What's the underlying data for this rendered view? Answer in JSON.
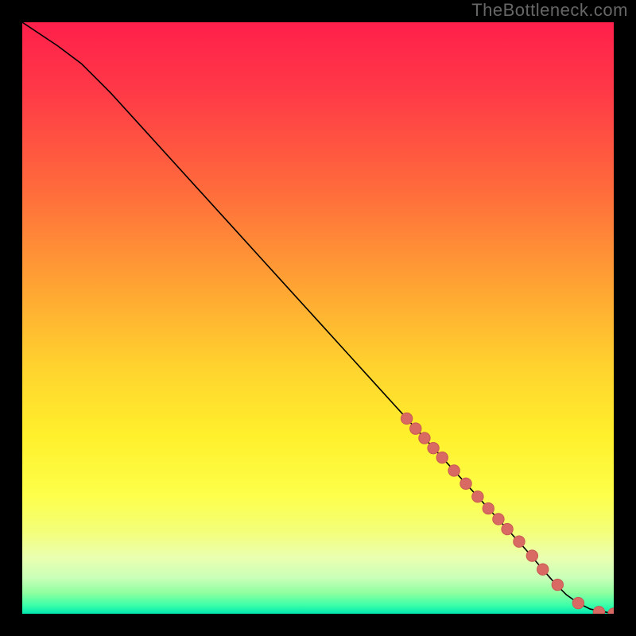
{
  "watermark": "TheBottleneck.com",
  "chart_data": {
    "type": "line",
    "xlim": [
      0,
      100
    ],
    "ylim": [
      0,
      100
    ],
    "xlabel": "",
    "ylabel": "",
    "title": "",
    "grid": false,
    "legend": false,
    "series": [
      {
        "name": "curve",
        "style": "solid-black",
        "x": [
          0,
          3,
          6,
          10,
          15,
          20,
          25,
          30,
          35,
          40,
          45,
          50,
          55,
          60,
          65,
          70,
          75,
          80,
          85,
          88,
          90,
          92,
          94,
          96,
          100
        ],
        "y": [
          100,
          98,
          96,
          93,
          88,
          82.5,
          77,
          71.5,
          66,
          60.5,
          55,
          49.5,
          44,
          38.5,
          33,
          27.5,
          22,
          16.5,
          11,
          7.5,
          5.2,
          3.2,
          1.8,
          0.8,
          0
        ]
      },
      {
        "name": "markers",
        "style": "dots-salmon",
        "x": [
          65,
          66.5,
          68,
          69.5,
          71,
          73,
          75,
          77,
          78.8,
          80.5,
          82,
          84,
          86.2,
          88,
          90.5,
          94,
          97.5,
          100
        ],
        "y": [
          33,
          31.3,
          29.7,
          28,
          26.4,
          24.2,
          22,
          19.8,
          17.8,
          16,
          14.3,
          12.2,
          9.8,
          7.5,
          4.9,
          1.8,
          0.3,
          0
        ]
      }
    ],
    "background_gradient": {
      "type": "vertical",
      "stops": [
        {
          "pos": 0.0,
          "color": "#ff1f4b"
        },
        {
          "pos": 0.12,
          "color": "#ff3a47"
        },
        {
          "pos": 0.28,
          "color": "#ff6a3c"
        },
        {
          "pos": 0.45,
          "color": "#ffa533"
        },
        {
          "pos": 0.58,
          "color": "#ffd22e"
        },
        {
          "pos": 0.7,
          "color": "#fff02c"
        },
        {
          "pos": 0.8,
          "color": "#fdff4a"
        },
        {
          "pos": 0.86,
          "color": "#f4ff78"
        },
        {
          "pos": 0.905,
          "color": "#eaffb0"
        },
        {
          "pos": 0.94,
          "color": "#c8ffb8"
        },
        {
          "pos": 0.965,
          "color": "#8effa0"
        },
        {
          "pos": 0.985,
          "color": "#3effa8"
        },
        {
          "pos": 1.0,
          "color": "#00e8b0"
        }
      ]
    },
    "colors": {
      "curve": "#000000",
      "marker_fill": "#d96a63",
      "marker_stroke": "#c85a53",
      "frame": "#000000"
    }
  }
}
